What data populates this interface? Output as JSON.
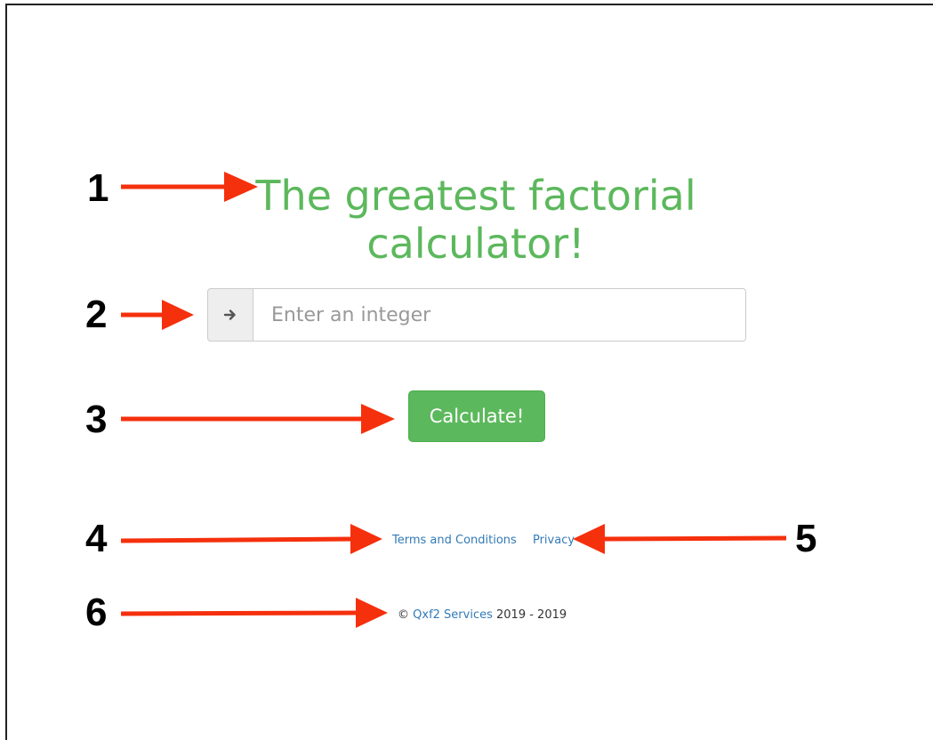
{
  "header": {
    "title": "The greatest factorial calculator!"
  },
  "form": {
    "input_placeholder": "Enter an integer",
    "input_value": "",
    "addon_icon": "arrow-right-icon",
    "calculate_label": "Calculate!"
  },
  "footer": {
    "terms_label": "Terms and Conditions",
    "privacy_label": "Privacy",
    "copyright_symbol": "©",
    "company_label": "Qxf2 Services",
    "years": "2019 - 2019"
  },
  "annotations": {
    "labels": [
      "1",
      "2",
      "3",
      "4",
      "5",
      "6"
    ],
    "arrow_color": "#f5300d"
  },
  "colors": {
    "accent": "#5cb85c",
    "link": "#337ab7"
  }
}
